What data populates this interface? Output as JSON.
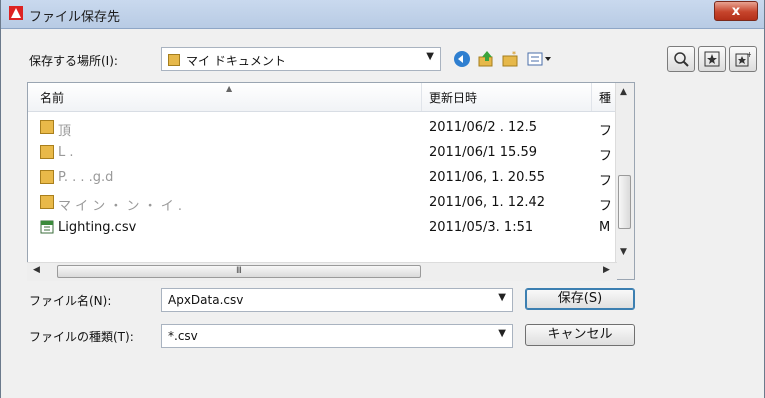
{
  "window": {
    "title": "ファイル保存先",
    "close_label": "x"
  },
  "location": {
    "label": "保存する場所(I):",
    "value": "マイ ドキュメント"
  },
  "toolbar": {
    "icons": [
      "back-icon",
      "up-folder-icon",
      "new-folder-icon",
      "views-menu-icon"
    ]
  },
  "side_buttons": [
    "find-icon",
    "favorites-icon",
    "add-favorite-icon"
  ],
  "file_list": {
    "columns": {
      "name": "名前",
      "modified": "更新日時",
      "type": "種"
    },
    "rows": [
      {
        "name": "頂",
        "modified": "2011/06/2 . 12.5",
        "type": "フ",
        "icon": "folder-icon"
      },
      {
        "name": "L .",
        "modified": "2011/06/1 15.59",
        "type": "フ",
        "icon": "folder-icon"
      },
      {
        "name": "P. . . .g.d",
        "modified": "2011/06, 1. 20.55",
        "type": "フ",
        "icon": "folder-icon"
      },
      {
        "name": "マ イ ン ・ ン ・ イ .",
        "modified": "2011/06, 1. 12.42",
        "type": "フ",
        "icon": "folder-icon"
      },
      {
        "name": "Lighting.csv",
        "modified": "2011/05/3. 1:51",
        "type": "M",
        "icon": "csv-file-icon"
      }
    ]
  },
  "filename": {
    "label": "ファイル名(N):",
    "value": "ApxData.csv"
  },
  "filetype": {
    "label": "ファイルの種類(T):",
    "value": "*.csv"
  },
  "buttons": {
    "save": "保存(S)",
    "cancel": "キャンセル"
  }
}
